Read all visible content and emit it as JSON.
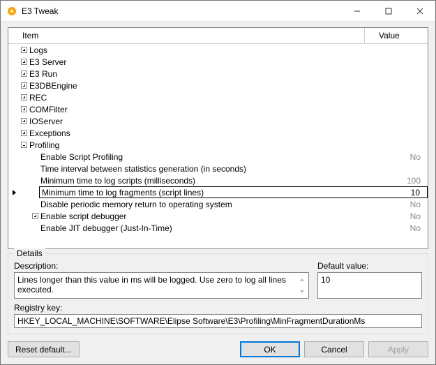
{
  "window": {
    "title": "E3 Tweak"
  },
  "columns": {
    "item": "Item",
    "value": "Value"
  },
  "tree": {
    "top": [
      {
        "label": "Logs"
      },
      {
        "label": "E3 Server"
      },
      {
        "label": "E3 Run"
      },
      {
        "label": "E3DBEngine"
      },
      {
        "label": "REC"
      },
      {
        "label": "COMFilter"
      },
      {
        "label": "IOServer"
      },
      {
        "label": "Exceptions"
      }
    ],
    "profiling": {
      "label": "Profiling",
      "children": [
        {
          "label": "Enable Script Profiling",
          "value": "No"
        },
        {
          "label": "Time interval between statistics generation (in seconds)",
          "value": ""
        },
        {
          "label": "Minimum time to log scripts (milliseconds)",
          "value": "100"
        },
        {
          "label": "Minimum time to log fragments (script lines)",
          "value": "10",
          "selected": true
        },
        {
          "label": "Disable periodic memory return to operating system",
          "value": "No"
        },
        {
          "label": "Enable script debugger",
          "value": "No",
          "expandable": true
        },
        {
          "label": "Enable JIT debugger (Just-In-Time)",
          "value": "No"
        }
      ]
    }
  },
  "details": {
    "group": "Details",
    "desc_label": "Description:",
    "desc_text": "Lines longer than this value in ms will be logged. Use zero to log all lines executed.",
    "default_label": "Default value:",
    "default_value": "10",
    "reg_label": "Registry key:",
    "reg_value": "HKEY_LOCAL_MACHINE\\SOFTWARE\\Elipse Software\\E3\\Profiling\\MinFragmentDurationMs"
  },
  "buttons": {
    "reset": "Reset default...",
    "ok": "OK",
    "cancel": "Cancel",
    "apply": "Apply"
  }
}
